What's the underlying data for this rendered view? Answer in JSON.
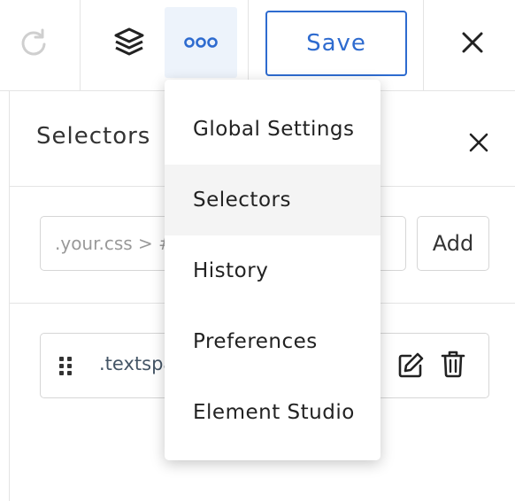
{
  "toolbar": {
    "save_label": "Save",
    "icons": {
      "redo": "redo-icon",
      "layers": "layers-icon",
      "more": "more-dots-icon",
      "close": "close-icon"
    },
    "accent_color": "#2e6bcf"
  },
  "panel": {
    "title": "Selectors",
    "input_placeholder": ".your.css > #selector",
    "add_label": "Add",
    "selectors": [
      {
        "name": ".textspan"
      }
    ]
  },
  "menu": {
    "items": [
      {
        "label": "Global Settings"
      },
      {
        "label": "Selectors",
        "active": true
      },
      {
        "label": "History"
      },
      {
        "label": "Preferences"
      },
      {
        "label": "Element Studio"
      }
    ]
  }
}
